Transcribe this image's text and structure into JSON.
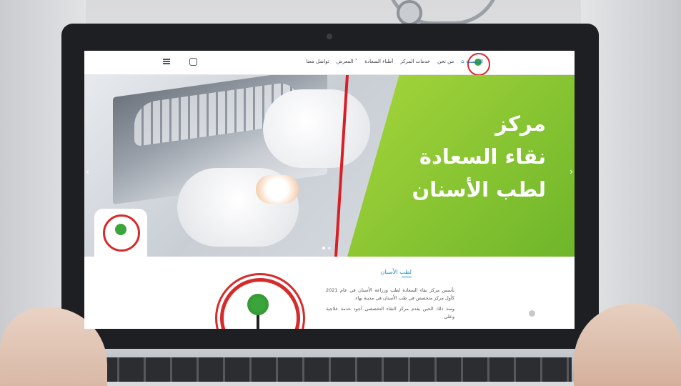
{
  "nav": {
    "items": [
      {
        "label": "الرئيسية",
        "icon": "home-icon",
        "active": true
      },
      {
        "label": "من نحن"
      },
      {
        "label": "خدمات المركز"
      },
      {
        "label": "أطباء السعادة"
      },
      {
        "label": "المعرض"
      },
      {
        "label": "تواصل معنا"
      }
    ],
    "instagram_icon": "instagram-icon",
    "menu_icon": "hamburger-menu-icon"
  },
  "hero": {
    "title_line1": "مركز",
    "title_line2": "نقاء السعادة",
    "title_line3": "لطب الأسنان",
    "slides_total": 2,
    "slide_active": 1
  },
  "about": {
    "title": "لطب الأسنان",
    "paragraph1": "تأسس مركز نقاء السعادة لطب وزراعة الأسنان في عام 2021 كأول مركز متخصص في طب الأسنان في مدينة بهاء.",
    "paragraph2": "ومنذ ذلك الحين يقدم مركز النقاء التخصصي أجود خدمة علاجية وعلى"
  },
  "colors": {
    "brand_green": "#7cc12f",
    "brand_red": "#d81f26",
    "link_blue": "#1f8fc9"
  }
}
